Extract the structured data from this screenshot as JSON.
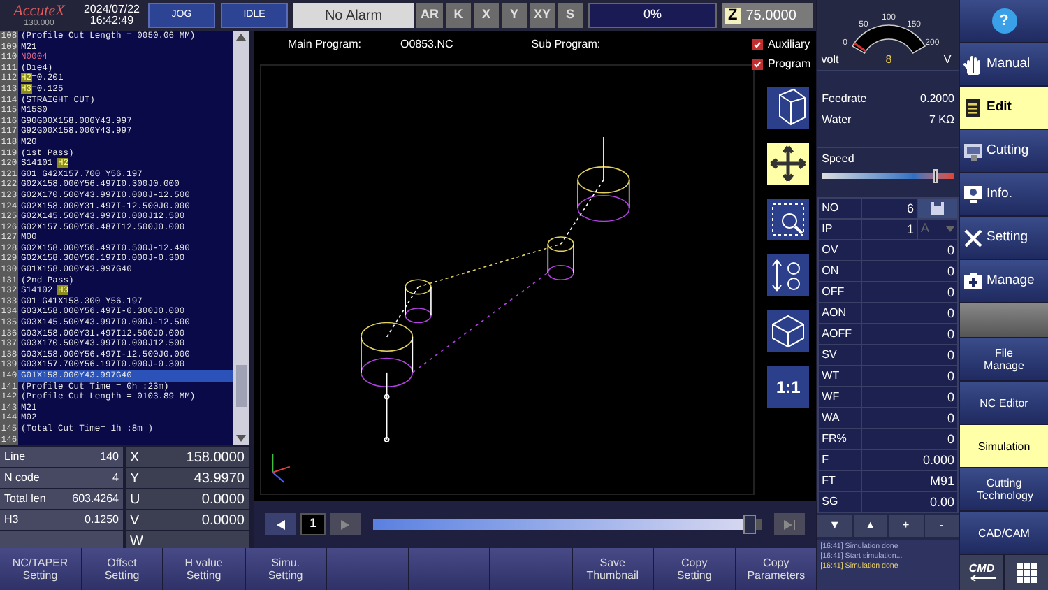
{
  "top_bar": {
    "logo": "AccuteX",
    "version": "130.000",
    "date": "2024/07/22",
    "time": "16:42:49",
    "mode_buttons": [
      "JOG",
      "IDLE"
    ],
    "alarm": "No Alarm",
    "axis_buttons": [
      "AR",
      "K",
      "X",
      "Y",
      "XY",
      "S"
    ],
    "progress": {
      "reading": "0%"
    },
    "z_icon": "Z",
    "z_value": "75.0000"
  },
  "code": {
    "lines": [
      {
        "number": "108",
        "text": "(Profile Cut Length = 0050.06 MM)",
        "kind": "code",
        "selected": false
      },
      {
        "number": "109",
        "text": "M21",
        "kind": "code",
        "selected": false
      },
      {
        "number": "110",
        "text": "N0004",
        "kind": "sequence",
        "selected": false
      },
      {
        "number": "111",
        "text": "(Die4)",
        "kind": "code",
        "selected": false
      },
      {
        "number": "112",
        "text": "**H2**=0.201",
        "kind": "code",
        "selected": false
      },
      {
        "number": "113",
        "text": "**H3**=0.125",
        "kind": "code",
        "selected": false
      },
      {
        "number": "114",
        "text": "(STRAIGHT CUT)",
        "kind": "code",
        "selected": false
      },
      {
        "number": "115",
        "text": "M15S0",
        "kind": "code",
        "selected": false
      },
      {
        "number": "116",
        "text": "G90G00X158.000Y43.997",
        "kind": "code",
        "selected": false
      },
      {
        "number": "117",
        "text": "G92G00X158.000Y43.997",
        "kind": "code",
        "selected": false
      },
      {
        "number": "118",
        "text": "M20",
        "kind": "code",
        "selected": false
      },
      {
        "number": "119",
        "text": "(1st Pass)",
        "kind": "code",
        "selected": false
      },
      {
        "number": "120",
        "text": "S14101 **H2**",
        "kind": "code",
        "selected": false
      },
      {
        "number": "121",
        "text": "G01 G42X157.700 Y56.197",
        "kind": "code",
        "selected": false
      },
      {
        "number": "122",
        "text": "G02X158.000Y56.497I0.300J0.000",
        "kind": "code",
        "selected": false
      },
      {
        "number": "123",
        "text": "G02X170.500Y43.997I0.000J-12.500",
        "kind": "code",
        "selected": false
      },
      {
        "number": "124",
        "text": "G02X158.000Y31.497I-12.500J0.000",
        "kind": "code",
        "selected": false
      },
      {
        "number": "125",
        "text": "G02X145.500Y43.997I0.000J12.500",
        "kind": "code",
        "selected": false
      },
      {
        "number": "126",
        "text": "G02X157.500Y56.487I12.500J0.000",
        "kind": "code",
        "selected": false
      },
      {
        "number": "127",
        "text": "M00",
        "kind": "code",
        "selected": false
      },
      {
        "number": "128",
        "text": "G02X158.000Y56.497I0.500J-12.490",
        "kind": "code",
        "selected": false
      },
      {
        "number": "129",
        "text": "G02X158.300Y56.197I0.000J-0.300",
        "kind": "code",
        "selected": false
      },
      {
        "number": "130",
        "text": "G01X158.000Y43.997G40",
        "kind": "code",
        "selected": false
      },
      {
        "number": "131",
        "text": "(2nd Pass)",
        "kind": "code",
        "selected": false
      },
      {
        "number": "132",
        "text": "S14102 **H3**",
        "kind": "code",
        "selected": false
      },
      {
        "number": "133",
        "text": "G01 G41X158.300 Y56.197",
        "kind": "code",
        "selected": false
      },
      {
        "number": "134",
        "text": "G03X158.000Y56.497I-0.300J0.000",
        "kind": "code",
        "selected": false
      },
      {
        "number": "135",
        "text": "G03X145.500Y43.997I0.000J-12.500",
        "kind": "code",
        "selected": false
      },
      {
        "number": "136",
        "text": "G03X158.000Y31.497I12.500J0.000",
        "kind": "code",
        "selected": false
      },
      {
        "number": "137",
        "text": "G03X170.500Y43.997I0.000J12.500",
        "kind": "code",
        "selected": false
      },
      {
        "number": "138",
        "text": "G03X158.000Y56.497I-12.500J0.000",
        "kind": "code",
        "selected": false
      },
      {
        "number": "139",
        "text": "G03X157.700Y56.197I0.000J-0.300",
        "kind": "code",
        "selected": false
      },
      {
        "number": "140",
        "text": "G01X158.000Y43.997G40",
        "kind": "code",
        "selected": true
      },
      {
        "number": "141",
        "text": "(Profile Cut Time = 0h :23m)",
        "kind": "code",
        "selected": false
      },
      {
        "number": "142",
        "text": "(Profile Cut Length = 0103.89 MM)",
        "kind": "code",
        "selected": false
      },
      {
        "number": "143",
        "text": "M21",
        "kind": "code",
        "selected": false
      },
      {
        "number": "144",
        "text": "M02",
        "kind": "code",
        "selected": false
      },
      {
        "number": "145",
        "text": "(Total Cut Time= 1h :8m )",
        "kind": "code",
        "selected": false
      },
      {
        "number": "146",
        "kind": "code",
        "selected": false
      }
    ]
  },
  "info": {
    "left": [
      {
        "label": "Line",
        "value": "140"
      },
      {
        "label": "N code",
        "value": "4"
      },
      {
        "label": "Total len",
        "value": "603.4264"
      },
      {
        "label": "H3",
        "value": "0.1250"
      }
    ],
    "right": [
      {
        "label": "X",
        "value": "158.0000"
      },
      {
        "label": "Y",
        "value": "43.9970"
      },
      {
        "label": "U",
        "value": "0.0000"
      },
      {
        "label": "V",
        "value": "0.0000"
      },
      {
        "label": "W"
      }
    ]
  },
  "viewer": {
    "main_program_label": "Main Program:",
    "main_program": "O0853.NC",
    "sub_program_label": "Sub Program:",
    "checkboxes": [
      {
        "label": "Auxiliary",
        "checked": true
      },
      {
        "label": "Program",
        "checked": true
      }
    ],
    "tools": [
      {
        "kind": "cube",
        "selected": false
      },
      {
        "kind": "move",
        "selected": true
      },
      {
        "kind": "zoom-box",
        "selected": false
      },
      {
        "kind": "zoom-in-out",
        "selected": false
      },
      {
        "kind": "view-3d",
        "selected": false
      },
      {
        "kind": "ratio",
        "text": "1:1",
        "selected": false
      }
    ]
  },
  "playback": {
    "step": "1",
    "level": 0.97
  },
  "bottom_buttons": [
    {
      "kind": "button",
      "label": "NC/TAPER Setting"
    },
    {
      "kind": "button",
      "label": "Offset Setting"
    },
    {
      "kind": "button",
      "label": "H value Setting"
    },
    {
      "kind": "button",
      "label": "Simu. Setting"
    },
    {
      "kind": "blank"
    },
    {
      "kind": "blank"
    },
    {
      "kind": "blank"
    },
    {
      "kind": "button",
      "label": "Save Thumbnail"
    },
    {
      "kind": "button",
      "label": "Copy Setting"
    },
    {
      "kind": "button",
      "label": "Copy Parameters"
    }
  ],
  "gauge": {
    "ticks": [
      "0",
      "50",
      "100",
      "150",
      "200"
    ],
    "unit_left": "volt",
    "reading": "8",
    "unit_right": "V",
    "level": 0.04
  },
  "readouts": [
    {
      "label": "Feedrate",
      "value": "0.2000"
    },
    {
      "label": "Water",
      "value": "7 KΩ"
    }
  ],
  "speed": {
    "label": "Speed",
    "level": 0.84
  },
  "params": [
    {
      "label": "NO",
      "value": "6",
      "kind": "save"
    },
    {
      "label": "IP",
      "value": "1",
      "unit": "A",
      "kind": "unit"
    },
    {
      "label": "OV",
      "value": "0",
      "kind": "plain"
    },
    {
      "label": "ON",
      "value": "0",
      "kind": "plain"
    },
    {
      "label": "OFF",
      "value": "0",
      "kind": "plain"
    },
    {
      "label": "AON",
      "value": "0",
      "kind": "plain"
    },
    {
      "label": "AOFF",
      "value": "0",
      "kind": "plain"
    },
    {
      "label": "SV",
      "value": "0",
      "kind": "plain"
    },
    {
      "label": "WT",
      "value": "0",
      "kind": "plain"
    },
    {
      "label": "WF",
      "value": "0",
      "kind": "plain"
    },
    {
      "label": "WA",
      "value": "0",
      "kind": "plain"
    },
    {
      "label": "FR%",
      "value": "0",
      "kind": "plain"
    },
    {
      "label": "F",
      "value": "0.000",
      "kind": "plain"
    },
    {
      "label": "FT",
      "value": "M91",
      "kind": "plain"
    },
    {
      "label": "SG",
      "value": "0.00",
      "kind": "plain"
    }
  ],
  "param_buttons": [
    "▼",
    "▲",
    "+",
    "-"
  ],
  "log": [
    {
      "text": "[16:41] Simulation done",
      "selected": false
    },
    {
      "text": "[16:41] Start simulation...",
      "selected": false
    },
    {
      "text": "[16:41] Simulation done",
      "selected": true
    }
  ],
  "help": "?",
  "main_nav": [
    {
      "label": "Manual",
      "kind": "hand",
      "selected": false
    },
    {
      "label": "Edit",
      "kind": "clipboard",
      "selected": true
    },
    {
      "label": "Cutting",
      "kind": "machine",
      "selected": false
    },
    {
      "label": "Info.",
      "kind": "monitor",
      "selected": false
    },
    {
      "label": "Setting",
      "kind": "tools",
      "selected": false
    },
    {
      "label": "Manage",
      "kind": "kit",
      "selected": false
    }
  ],
  "sub_nav": [
    {
      "label": "File Manage",
      "selected": false
    },
    {
      "label": "NC Editor",
      "selected": false
    },
    {
      "label": "Simulation",
      "selected": true
    },
    {
      "label": "Cutting Technology",
      "selected": false
    },
    {
      "label": "CAD/CAM",
      "selected": false
    }
  ],
  "cmd": "CMD"
}
